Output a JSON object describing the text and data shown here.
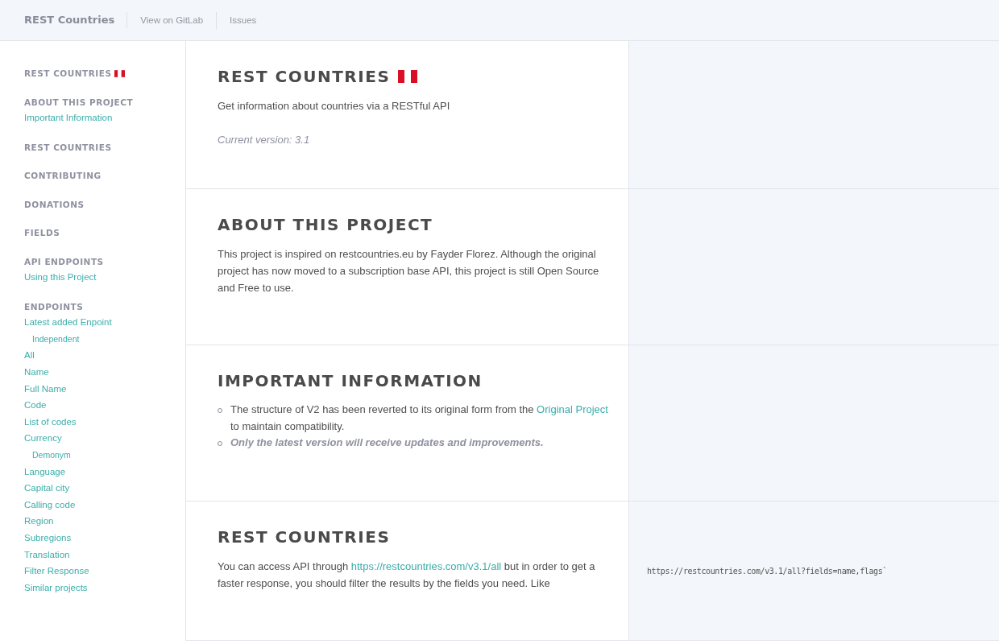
{
  "navbar": {
    "brand": "REST Countries",
    "links": [
      "View on GitLab",
      "Issues"
    ]
  },
  "sidebar": [
    {
      "heading": "REST COUNTRIES",
      "has_flag": true
    },
    {
      "heading": "ABOUT THIS PROJECT",
      "has_flag": false,
      "items": [
        {
          "label": "Important Information"
        }
      ]
    },
    {
      "heading": "REST COUNTRIES",
      "has_flag": false
    },
    {
      "heading": "CONTRIBUTING",
      "has_flag": false
    },
    {
      "heading": "DONATIONS",
      "has_flag": false
    },
    {
      "heading": "FIELDS",
      "has_flag": false
    },
    {
      "heading": "API ENDPOINTS",
      "has_flag": false,
      "items": [
        {
          "label": "Using this Project"
        }
      ]
    },
    {
      "heading": "ENDPOINTS",
      "has_flag": false,
      "items": [
        {
          "label": "Latest added Enpoint",
          "children": [
            {
              "label": "Independent"
            }
          ]
        },
        {
          "label": "All"
        },
        {
          "label": "Name"
        },
        {
          "label": "Full Name"
        },
        {
          "label": "Code"
        },
        {
          "label": "List of codes"
        },
        {
          "label": "Currency",
          "children": [
            {
              "label": "Demonym"
            }
          ]
        },
        {
          "label": "Language"
        },
        {
          "label": "Capital city"
        },
        {
          "label": "Calling code"
        },
        {
          "label": "Region"
        },
        {
          "label": "Subregions"
        },
        {
          "label": "Translation"
        },
        {
          "label": "Filter Response"
        },
        {
          "label": "Similar projects"
        }
      ]
    }
  ],
  "sections": [
    {
      "title": "REST COUNTRIES",
      "has_flag": true,
      "blocks": [
        {
          "kind": "paragraph",
          "parts": [
            {
              "text": "Get information about countries via a RESTful API"
            }
          ]
        },
        {
          "kind": "note",
          "parts": [
            {
              "text": "Current version: 3.1"
            }
          ]
        }
      ]
    },
    {
      "title": "ABOUT THIS PROJECT",
      "has_flag": false,
      "blocks": [
        {
          "kind": "paragraph",
          "parts": [
            {
              "text": "This project is inspired on restcountries.eu by Fayder Florez. Although the original project has now moved to a subscription base API, this project is still Open Source and Free to use."
            }
          ]
        }
      ]
    },
    {
      "title": "IMPORTANT INFORMATION",
      "has_flag": false,
      "blocks": [
        {
          "kind": "list",
          "items": [
            {
              "emphasis": false,
              "parts": [
                {
                  "text": "The structure of V2 has been reverted to its original form from the "
                },
                {
                  "link": "Original Project"
                },
                {
                  "text": " to maintain compatibility."
                }
              ]
            },
            {
              "emphasis": true,
              "parts": [
                {
                  "text": "Only the latest version will receive updates and improvements."
                }
              ]
            }
          ]
        }
      ]
    },
    {
      "title": "REST COUNTRIES",
      "has_flag": false,
      "code": "https://restcountries.com/v3.1/all?fields=name,flags`",
      "blocks": [
        {
          "kind": "paragraph",
          "parts": [
            {
              "text": "You can access API through "
            },
            {
              "link": "https://restcountries.com/v3.1/all"
            },
            {
              "text": " but in order to get a faster response, you should filter the results by the fields you need. Like"
            }
          ]
        }
      ]
    }
  ]
}
